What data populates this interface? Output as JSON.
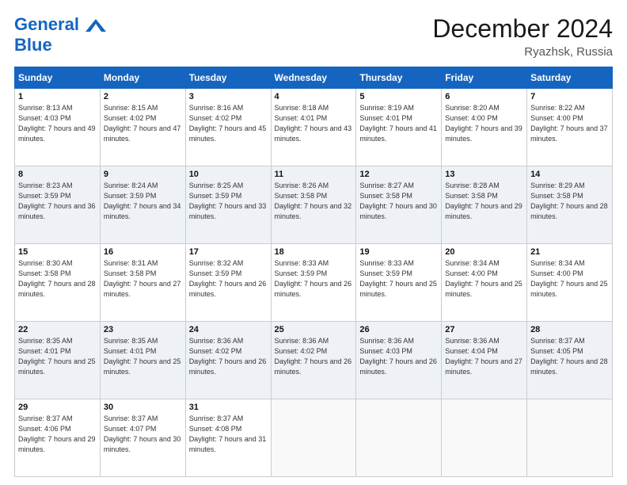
{
  "header": {
    "logo_line1": "General",
    "logo_line2": "Blue",
    "month_title": "December 2024",
    "location": "Ryazhsk, Russia"
  },
  "weekdays": [
    "Sunday",
    "Monday",
    "Tuesday",
    "Wednesday",
    "Thursday",
    "Friday",
    "Saturday"
  ],
  "weeks": [
    [
      {
        "day": "1",
        "sunrise": "8:13 AM",
        "sunset": "4:03 PM",
        "daylight": "7 hours and 49 minutes."
      },
      {
        "day": "2",
        "sunrise": "8:15 AM",
        "sunset": "4:02 PM",
        "daylight": "7 hours and 47 minutes."
      },
      {
        "day": "3",
        "sunrise": "8:16 AM",
        "sunset": "4:02 PM",
        "daylight": "7 hours and 45 minutes."
      },
      {
        "day": "4",
        "sunrise": "8:18 AM",
        "sunset": "4:01 PM",
        "daylight": "7 hours and 43 minutes."
      },
      {
        "day": "5",
        "sunrise": "8:19 AM",
        "sunset": "4:01 PM",
        "daylight": "7 hours and 41 minutes."
      },
      {
        "day": "6",
        "sunrise": "8:20 AM",
        "sunset": "4:00 PM",
        "daylight": "7 hours and 39 minutes."
      },
      {
        "day": "7",
        "sunrise": "8:22 AM",
        "sunset": "4:00 PM",
        "daylight": "7 hours and 37 minutes."
      }
    ],
    [
      {
        "day": "8",
        "sunrise": "8:23 AM",
        "sunset": "3:59 PM",
        "daylight": "7 hours and 36 minutes."
      },
      {
        "day": "9",
        "sunrise": "8:24 AM",
        "sunset": "3:59 PM",
        "daylight": "7 hours and 34 minutes."
      },
      {
        "day": "10",
        "sunrise": "8:25 AM",
        "sunset": "3:59 PM",
        "daylight": "7 hours and 33 minutes."
      },
      {
        "day": "11",
        "sunrise": "8:26 AM",
        "sunset": "3:58 PM",
        "daylight": "7 hours and 32 minutes."
      },
      {
        "day": "12",
        "sunrise": "8:27 AM",
        "sunset": "3:58 PM",
        "daylight": "7 hours and 30 minutes."
      },
      {
        "day": "13",
        "sunrise": "8:28 AM",
        "sunset": "3:58 PM",
        "daylight": "7 hours and 29 minutes."
      },
      {
        "day": "14",
        "sunrise": "8:29 AM",
        "sunset": "3:58 PM",
        "daylight": "7 hours and 28 minutes."
      }
    ],
    [
      {
        "day": "15",
        "sunrise": "8:30 AM",
        "sunset": "3:58 PM",
        "daylight": "7 hours and 28 minutes."
      },
      {
        "day": "16",
        "sunrise": "8:31 AM",
        "sunset": "3:58 PM",
        "daylight": "7 hours and 27 minutes."
      },
      {
        "day": "17",
        "sunrise": "8:32 AM",
        "sunset": "3:59 PM",
        "daylight": "7 hours and 26 minutes."
      },
      {
        "day": "18",
        "sunrise": "8:33 AM",
        "sunset": "3:59 PM",
        "daylight": "7 hours and 26 minutes."
      },
      {
        "day": "19",
        "sunrise": "8:33 AM",
        "sunset": "3:59 PM",
        "daylight": "7 hours and 25 minutes."
      },
      {
        "day": "20",
        "sunrise": "8:34 AM",
        "sunset": "4:00 PM",
        "daylight": "7 hours and 25 minutes."
      },
      {
        "day": "21",
        "sunrise": "8:34 AM",
        "sunset": "4:00 PM",
        "daylight": "7 hours and 25 minutes."
      }
    ],
    [
      {
        "day": "22",
        "sunrise": "8:35 AM",
        "sunset": "4:01 PM",
        "daylight": "7 hours and 25 minutes."
      },
      {
        "day": "23",
        "sunrise": "8:35 AM",
        "sunset": "4:01 PM",
        "daylight": "7 hours and 25 minutes."
      },
      {
        "day": "24",
        "sunrise": "8:36 AM",
        "sunset": "4:02 PM",
        "daylight": "7 hours and 26 minutes."
      },
      {
        "day": "25",
        "sunrise": "8:36 AM",
        "sunset": "4:02 PM",
        "daylight": "7 hours and 26 minutes."
      },
      {
        "day": "26",
        "sunrise": "8:36 AM",
        "sunset": "4:03 PM",
        "daylight": "7 hours and 26 minutes."
      },
      {
        "day": "27",
        "sunrise": "8:36 AM",
        "sunset": "4:04 PM",
        "daylight": "7 hours and 27 minutes."
      },
      {
        "day": "28",
        "sunrise": "8:37 AM",
        "sunset": "4:05 PM",
        "daylight": "7 hours and 28 minutes."
      }
    ],
    [
      {
        "day": "29",
        "sunrise": "8:37 AM",
        "sunset": "4:06 PM",
        "daylight": "7 hours and 29 minutes."
      },
      {
        "day": "30",
        "sunrise": "8:37 AM",
        "sunset": "4:07 PM",
        "daylight": "7 hours and 30 minutes."
      },
      {
        "day": "31",
        "sunrise": "8:37 AM",
        "sunset": "4:08 PM",
        "daylight": "7 hours and 31 minutes."
      },
      null,
      null,
      null,
      null
    ]
  ]
}
